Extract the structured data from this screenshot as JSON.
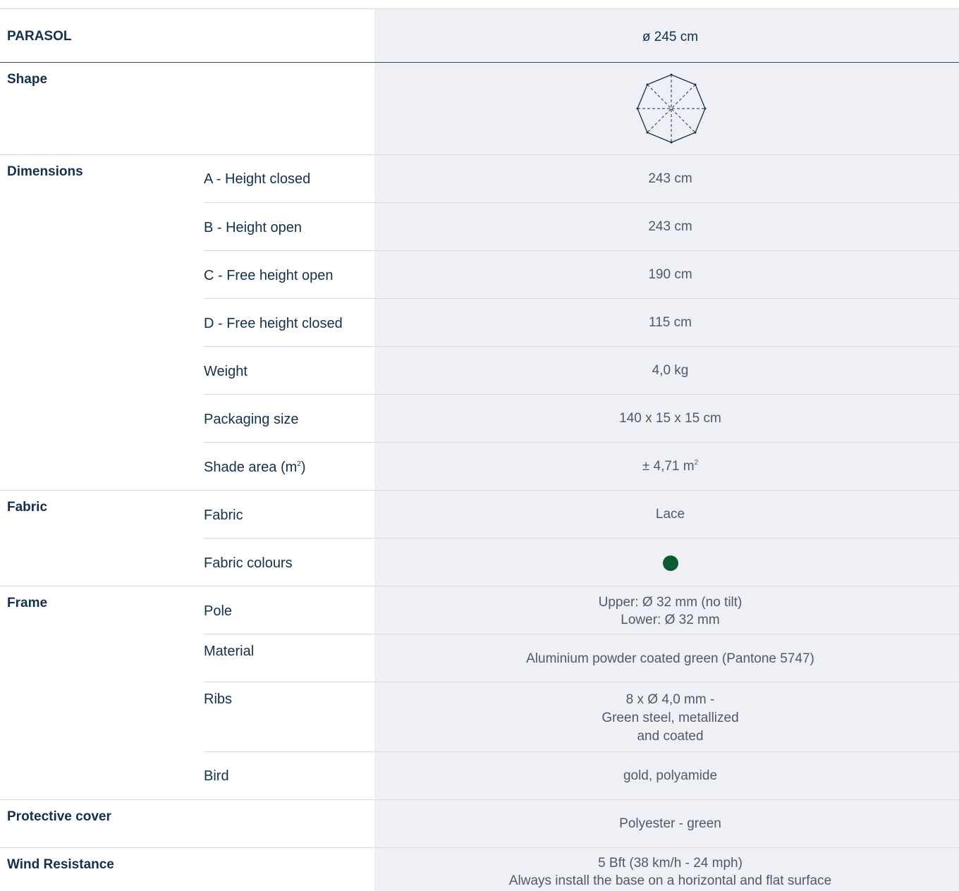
{
  "header": {
    "title": "PARASOL",
    "size": "ø 245 cm"
  },
  "shape": {
    "label": "Shape",
    "icon": "octagon-parasol-icon"
  },
  "dimensions": {
    "label": "Dimensions",
    "rows": [
      {
        "label": "A - Height closed",
        "value": "243 cm"
      },
      {
        "label": "B - Height open",
        "value": "243 cm"
      },
      {
        "label": "C - Free height open",
        "value": "190 cm"
      },
      {
        "label": "D - Free height closed",
        "value": "115 cm"
      },
      {
        "label": "Weight",
        "value": "4,0 kg"
      },
      {
        "label": "Packaging size",
        "value": "140 x 15 x 15 cm"
      },
      {
        "label": "Shade area (m",
        "label_sup": "2",
        "label_end": ")",
        "value": "± 4,71 m",
        "value_sup": "2"
      }
    ]
  },
  "fabric": {
    "label": "Fabric",
    "fabric_label": "Fabric",
    "fabric_value": "Lace",
    "colours_label": "Fabric colours",
    "colour": "#0d5a33"
  },
  "frame": {
    "label": "Frame",
    "pole_label": "Pole",
    "pole_lines": [
      "Upper: Ø 32 mm (no tilt)",
      "Lower: Ø 32 mm"
    ],
    "material_label": "Material",
    "material_value": "Aluminium powder coated green (Pantone 5747)",
    "ribs_label": "Ribs",
    "ribs_lines": [
      "8 x Ø 4,0 mm -",
      "Green steel, metallized",
      "and coated"
    ],
    "bird_label": "Bird",
    "bird_value": "gold, polyamide"
  },
  "cover": {
    "label": "Protective cover",
    "value": "Polyester - green"
  },
  "wind": {
    "label": "Wind Resistance",
    "lines": [
      "5 Bft (38 km/h - 24 mph)",
      "Always install the base on a horizontal and flat surface"
    ]
  },
  "colors": {
    "text": "#13304e",
    "value_text": "#4f5a67",
    "value_bg": "#eff0f5"
  }
}
